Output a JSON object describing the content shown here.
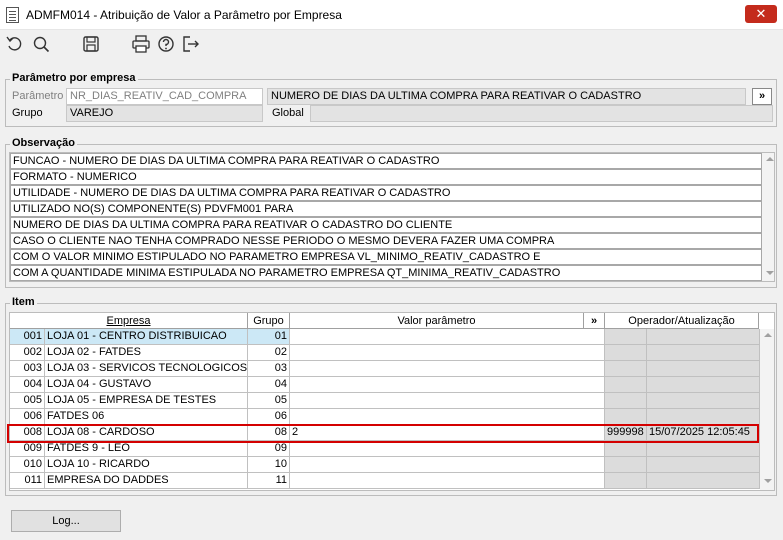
{
  "window": {
    "title": "ADMFM014 - Atribuição de Valor a Parâmetro por Empresa",
    "close_glyph": "✕"
  },
  "toolbar": {
    "icons": [
      "refresh-icon",
      "search-icon",
      "save-icon",
      "print-icon",
      "help-icon",
      "exit-icon"
    ]
  },
  "param_section": {
    "title": "Parâmetro por empresa",
    "parametro_label": "Parâmetro",
    "parametro_value": "NR_DIAS_REATIV_CAD_COMPRA",
    "parametro_desc": "NUMERO DE DIAS DA ULTIMA COMPRA PARA REATIVAR O CADASTRO",
    "lookup_label": "»",
    "grupo_label": "Grupo",
    "grupo_value": "VAREJO",
    "global_label": "Global",
    "global_value": ""
  },
  "obs_section": {
    "title": "Observação",
    "lines": [
      "FUNCAO - NUMERO DE DIAS DA ULTIMA COMPRA PARA REATIVAR O CADASTRO",
      "FORMATO - NUMERICO",
      "UTILIDADE - NUMERO DE DIAS DA ULTIMA COMPRA PARA REATIVAR O CADASTRO",
      "UTILIZADO NO(S) COMPONENTE(S) PDVFM001 PARA",
      "NUMERO DE DIAS DA ULTIMA COMPRA PARA REATIVAR O CADASTRO DO CLIENTE",
      "CASO O CLIENTE NAO TENHA COMPRADO NESSE PERIODO O MESMO DEVERA FAZER UMA COMPRA",
      "COM O VALOR MINIMO ESTIPULADO NO PARAMETRO EMPRESA VL_MINIMO_REATIV_CADASTRO E",
      "COM A QUANTIDADE MINIMA ESTIPULADA NO PARAMETRO EMPRESA QT_MINIMA_REATIV_CADASTRO"
    ]
  },
  "item_section": {
    "title": "Item",
    "headers": {
      "empresa": "Empresa",
      "grupo": "Grupo",
      "valor": "Valor parâmetro",
      "expand": "»",
      "operador": "Operador/Atualização"
    },
    "rows": [
      {
        "code": "001",
        "name": "LOJA 01 - CENTRO DISTRIBUICAO",
        "grupo": "01",
        "valor": "",
        "operador": "",
        "data": ""
      },
      {
        "code": "002",
        "name": "LOJA 02 - FATDES",
        "grupo": "02",
        "valor": "",
        "operador": "",
        "data": ""
      },
      {
        "code": "003",
        "name": "LOJA 03 - SERVICOS TECNOLOGICOS LTDA",
        "grupo": "03",
        "valor": "",
        "operador": "",
        "data": ""
      },
      {
        "code": "004",
        "name": "LOJA 04 - GUSTAVO",
        "grupo": "04",
        "valor": "",
        "operador": "",
        "data": ""
      },
      {
        "code": "005",
        "name": "LOJA 05 - EMPRESA DE TESTES",
        "grupo": "05",
        "valor": "",
        "operador": "",
        "data": ""
      },
      {
        "code": "006",
        "name": "FATDES 06",
        "grupo": "06",
        "valor": "",
        "operador": "",
        "data": ""
      },
      {
        "code": "008",
        "name": "LOJA 08 - CARDOSO",
        "grupo": "08",
        "valor": "2",
        "operador": "999998",
        "data": "15/07/2025 12:05:45"
      },
      {
        "code": "009",
        "name": "FATDES 9 - LEO",
        "grupo": "09",
        "valor": "",
        "operador": "",
        "data": ""
      },
      {
        "code": "010",
        "name": "LOJA 10 - RICARDO",
        "grupo": "10",
        "valor": "",
        "operador": "",
        "data": ""
      },
      {
        "code": "011",
        "name": "EMPRESA DO DADDES",
        "grupo": "11",
        "valor": "",
        "operador": "",
        "data": ""
      }
    ]
  },
  "log_button": "Log...",
  "colors": {
    "highlight": "#d40000",
    "selected_row": "#cce8f6",
    "close": "#c42b1c"
  }
}
